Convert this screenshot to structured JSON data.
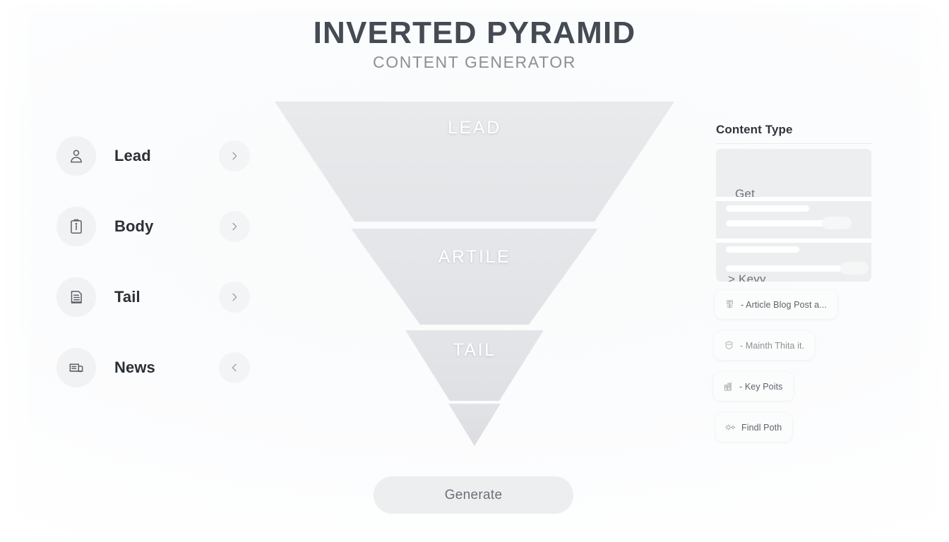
{
  "header": {
    "title": "INVERTED PYRAMID",
    "subtitle": "CONTENT GENERATOR"
  },
  "nav": {
    "items": [
      {
        "label": "Lead",
        "icon": "person-icon",
        "chevron": "chevron-right-icon"
      },
      {
        "label": "Body",
        "icon": "clipboard-info-icon",
        "chevron": "chevron-right-icon"
      },
      {
        "label": "Tail",
        "icon": "document-lines-icon",
        "chevron": "chevron-right-icon"
      },
      {
        "label": "News",
        "icon": "newspaper-icon",
        "chevron": "chevron-left-icon"
      }
    ]
  },
  "funnel": {
    "segments": [
      {
        "label": "LEAD"
      },
      {
        "label": "ARTILE"
      },
      {
        "label": "TAIL"
      },
      {
        "label": ""
      }
    ]
  },
  "actions": {
    "generate_label": "Generate"
  },
  "side_panel": {
    "title": "Content Type",
    "preview": {
      "primary_text": "Get",
      "secondary_text": "> Keyy"
    },
    "chips": [
      {
        "label": "- Article Blog Post a...",
        "icon": "article-icon"
      },
      {
        "label": "- Mainth Thita it.",
        "icon": "shield-icon"
      },
      {
        "label": "- Key Poits",
        "icon": "chart-bars-icon"
      },
      {
        "label": "Findl Poth",
        "icon": "gears-icon"
      }
    ]
  },
  "colors": {
    "page_background": "#ffffff",
    "title_text": "#454b54",
    "subtitle_text": "#8a9096",
    "funnel_fill": "#e6e7e9",
    "funnel_label": "#ffffff",
    "button_background": "#eceef0",
    "button_text": "#6b7178",
    "panel_skeleton": "#eceeef"
  }
}
